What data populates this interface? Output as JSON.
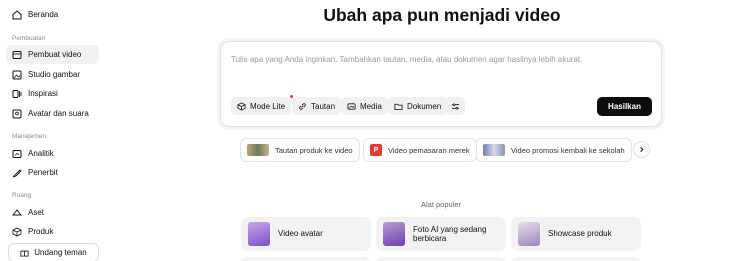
{
  "sidebar": {
    "home": "Beranda",
    "section_create": "Pembuatan",
    "items": [
      {
        "label": "Pembuat video",
        "icon": "video-icon",
        "active": true
      },
      {
        "label": "Studio gambar",
        "icon": "image-icon",
        "active": false
      },
      {
        "label": "Inspirasi",
        "icon": "inspiration-icon",
        "active": false
      },
      {
        "label": "Avatar dan suara",
        "icon": "avatar-icon",
        "active": false
      }
    ],
    "section_management": "Manajemen",
    "management_items": [
      {
        "label": "Analitik",
        "icon": "analytics-icon"
      },
      {
        "label": "Penerbit",
        "icon": "publisher-icon"
      }
    ],
    "section_space": "Ruang",
    "space_items": [
      {
        "label": "Aset",
        "icon": "assets-icon"
      },
      {
        "label": "Produk",
        "icon": "product-icon"
      }
    ],
    "invite": "Undang teman"
  },
  "main": {
    "title": "Ubah apa pun menjadi video",
    "prompt": {
      "placeholder": "Tulis apa yang Anda inginkan. Tambahkan tautan, media, atau dokumen agar hasilnya lebih akurat.",
      "tools": {
        "mode": "Mode Lite",
        "link": "Tautan",
        "media": "Media",
        "document": "Dokumen"
      },
      "generate": "Hasilkan"
    },
    "suggestions": [
      "Tautan produk ke video",
      "Video pemasaran merek",
      "Video promosi kembali ke sekolah"
    ],
    "suggestion_badge": "P",
    "popular_label": "Alat populer",
    "popular_tools": [
      "Video avatar",
      "Foto AI yang sedang berbicara",
      "Showcase produk"
    ]
  },
  "colors": {
    "accent": "#0d0d0d",
    "active_bg": "#f1f1f1",
    "card_bg": "#f2f2f2",
    "notification": "#e53935"
  }
}
